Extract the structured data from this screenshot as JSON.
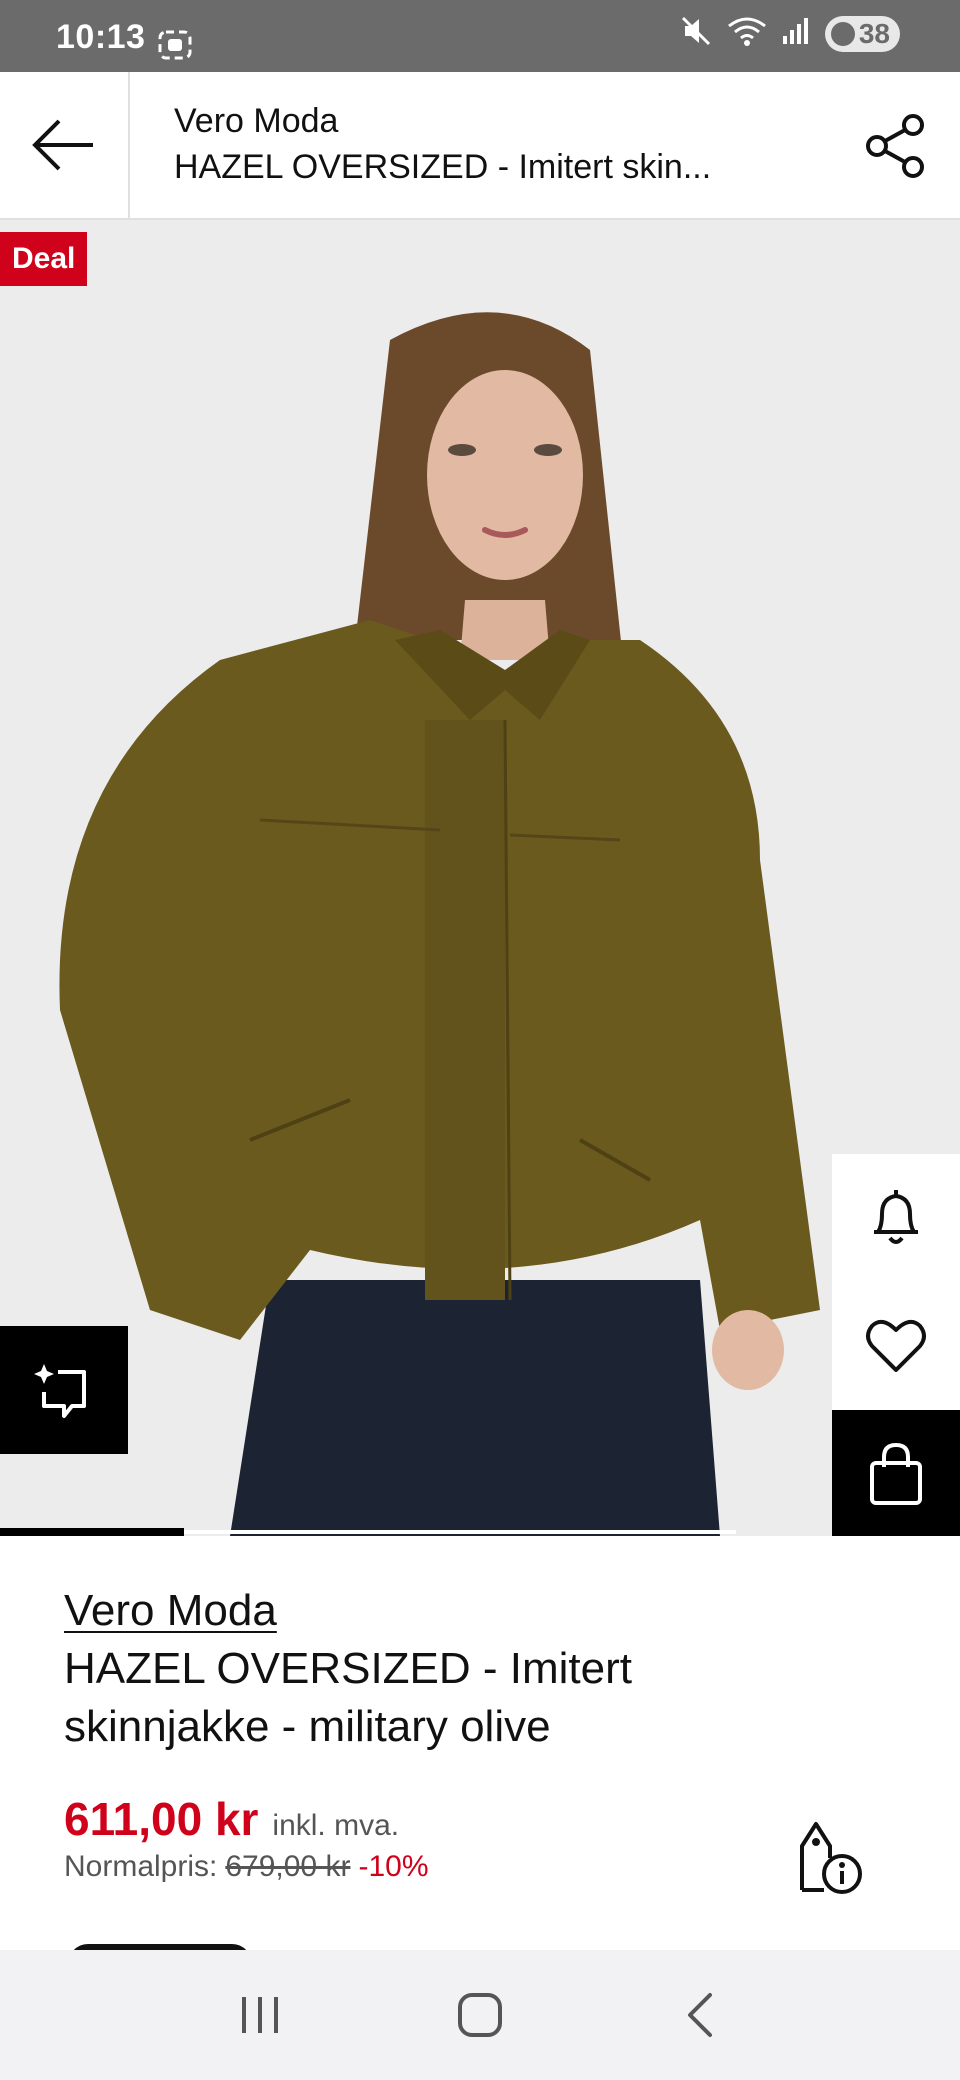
{
  "status_bar": {
    "time": "10:13",
    "battery": "38"
  },
  "header": {
    "brand": "Vero Moda",
    "title": "HAZEL OVERSIZED - Imitert skin..."
  },
  "hero": {
    "badge": "Deal"
  },
  "product": {
    "brand": "Vero Moda",
    "title": "HAZEL OVERSIZED - Imitert skinnjakke - military olive",
    "price": "611,00 kr",
    "vat_note": "inkl. mva.",
    "normal_label": "Normalpris:",
    "normal_price": "679,00 kr",
    "discount": "-10%"
  },
  "colors": {
    "accent_red": "#d0021b",
    "jacket_olive": "#6b5a1e",
    "jeans": "#1c2433"
  },
  "icons": [
    "screen-record-icon",
    "mute-icon",
    "wifi-icon",
    "signal-icon",
    "back-arrow-icon",
    "share-icon",
    "ai-search-icon",
    "bell-icon",
    "heart-icon",
    "shopping-bag-icon",
    "price-tag-info-icon",
    "recent-apps-icon",
    "home-icon",
    "nav-back-icon"
  ]
}
